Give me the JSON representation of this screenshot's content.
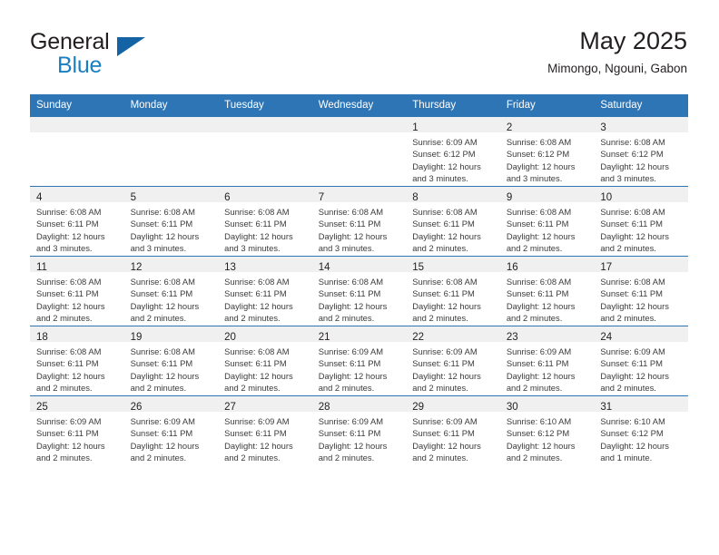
{
  "brand": {
    "line1": "General",
    "line2": "Blue",
    "flag_color": "#1464a5",
    "blue_color": "#1a7fc1"
  },
  "header": {
    "title": "May 2025",
    "subtitle": "Mimongo, Ngouni, Gabon"
  },
  "theme": {
    "header_bg": "#2e75b6",
    "daynum_bg": "#f0f0f0",
    "text": "#231f20"
  },
  "weekday_headers": [
    "Sunday",
    "Monday",
    "Tuesday",
    "Wednesday",
    "Thursday",
    "Friday",
    "Saturday"
  ],
  "labels": {
    "sunrise_prefix": "Sunrise:",
    "sunset_prefix": "Sunset:",
    "daylight_prefix": "Daylight:"
  },
  "weeks": [
    [
      {
        "day": "",
        "empty": true
      },
      {
        "day": "",
        "empty": true
      },
      {
        "day": "",
        "empty": true
      },
      {
        "day": "",
        "empty": true
      },
      {
        "day": "1",
        "sunrise": "Sunrise: 6:09 AM",
        "sunset": "Sunset: 6:12 PM",
        "daylight_1": "Daylight: 12 hours",
        "daylight_2": "and 3 minutes."
      },
      {
        "day": "2",
        "sunrise": "Sunrise: 6:08 AM",
        "sunset": "Sunset: 6:12 PM",
        "daylight_1": "Daylight: 12 hours",
        "daylight_2": "and 3 minutes."
      },
      {
        "day": "3",
        "sunrise": "Sunrise: 6:08 AM",
        "sunset": "Sunset: 6:12 PM",
        "daylight_1": "Daylight: 12 hours",
        "daylight_2": "and 3 minutes."
      }
    ],
    [
      {
        "day": "4",
        "sunrise": "Sunrise: 6:08 AM",
        "sunset": "Sunset: 6:11 PM",
        "daylight_1": "Daylight: 12 hours",
        "daylight_2": "and 3 minutes."
      },
      {
        "day": "5",
        "sunrise": "Sunrise: 6:08 AM",
        "sunset": "Sunset: 6:11 PM",
        "daylight_1": "Daylight: 12 hours",
        "daylight_2": "and 3 minutes."
      },
      {
        "day": "6",
        "sunrise": "Sunrise: 6:08 AM",
        "sunset": "Sunset: 6:11 PM",
        "daylight_1": "Daylight: 12 hours",
        "daylight_2": "and 3 minutes."
      },
      {
        "day": "7",
        "sunrise": "Sunrise: 6:08 AM",
        "sunset": "Sunset: 6:11 PM",
        "daylight_1": "Daylight: 12 hours",
        "daylight_2": "and 3 minutes."
      },
      {
        "day": "8",
        "sunrise": "Sunrise: 6:08 AM",
        "sunset": "Sunset: 6:11 PM",
        "daylight_1": "Daylight: 12 hours",
        "daylight_2": "and 2 minutes."
      },
      {
        "day": "9",
        "sunrise": "Sunrise: 6:08 AM",
        "sunset": "Sunset: 6:11 PM",
        "daylight_1": "Daylight: 12 hours",
        "daylight_2": "and 2 minutes."
      },
      {
        "day": "10",
        "sunrise": "Sunrise: 6:08 AM",
        "sunset": "Sunset: 6:11 PM",
        "daylight_1": "Daylight: 12 hours",
        "daylight_2": "and 2 minutes."
      }
    ],
    [
      {
        "day": "11",
        "sunrise": "Sunrise: 6:08 AM",
        "sunset": "Sunset: 6:11 PM",
        "daylight_1": "Daylight: 12 hours",
        "daylight_2": "and 2 minutes."
      },
      {
        "day": "12",
        "sunrise": "Sunrise: 6:08 AM",
        "sunset": "Sunset: 6:11 PM",
        "daylight_1": "Daylight: 12 hours",
        "daylight_2": "and 2 minutes."
      },
      {
        "day": "13",
        "sunrise": "Sunrise: 6:08 AM",
        "sunset": "Sunset: 6:11 PM",
        "daylight_1": "Daylight: 12 hours",
        "daylight_2": "and 2 minutes."
      },
      {
        "day": "14",
        "sunrise": "Sunrise: 6:08 AM",
        "sunset": "Sunset: 6:11 PM",
        "daylight_1": "Daylight: 12 hours",
        "daylight_2": "and 2 minutes."
      },
      {
        "day": "15",
        "sunrise": "Sunrise: 6:08 AM",
        "sunset": "Sunset: 6:11 PM",
        "daylight_1": "Daylight: 12 hours",
        "daylight_2": "and 2 minutes."
      },
      {
        "day": "16",
        "sunrise": "Sunrise: 6:08 AM",
        "sunset": "Sunset: 6:11 PM",
        "daylight_1": "Daylight: 12 hours",
        "daylight_2": "and 2 minutes."
      },
      {
        "day": "17",
        "sunrise": "Sunrise: 6:08 AM",
        "sunset": "Sunset: 6:11 PM",
        "daylight_1": "Daylight: 12 hours",
        "daylight_2": "and 2 minutes."
      }
    ],
    [
      {
        "day": "18",
        "sunrise": "Sunrise: 6:08 AM",
        "sunset": "Sunset: 6:11 PM",
        "daylight_1": "Daylight: 12 hours",
        "daylight_2": "and 2 minutes."
      },
      {
        "day": "19",
        "sunrise": "Sunrise: 6:08 AM",
        "sunset": "Sunset: 6:11 PM",
        "daylight_1": "Daylight: 12 hours",
        "daylight_2": "and 2 minutes."
      },
      {
        "day": "20",
        "sunrise": "Sunrise: 6:08 AM",
        "sunset": "Sunset: 6:11 PM",
        "daylight_1": "Daylight: 12 hours",
        "daylight_2": "and 2 minutes."
      },
      {
        "day": "21",
        "sunrise": "Sunrise: 6:09 AM",
        "sunset": "Sunset: 6:11 PM",
        "daylight_1": "Daylight: 12 hours",
        "daylight_2": "and 2 minutes."
      },
      {
        "day": "22",
        "sunrise": "Sunrise: 6:09 AM",
        "sunset": "Sunset: 6:11 PM",
        "daylight_1": "Daylight: 12 hours",
        "daylight_2": "and 2 minutes."
      },
      {
        "day": "23",
        "sunrise": "Sunrise: 6:09 AM",
        "sunset": "Sunset: 6:11 PM",
        "daylight_1": "Daylight: 12 hours",
        "daylight_2": "and 2 minutes."
      },
      {
        "day": "24",
        "sunrise": "Sunrise: 6:09 AM",
        "sunset": "Sunset: 6:11 PM",
        "daylight_1": "Daylight: 12 hours",
        "daylight_2": "and 2 minutes."
      }
    ],
    [
      {
        "day": "25",
        "sunrise": "Sunrise: 6:09 AM",
        "sunset": "Sunset: 6:11 PM",
        "daylight_1": "Daylight: 12 hours",
        "daylight_2": "and 2 minutes."
      },
      {
        "day": "26",
        "sunrise": "Sunrise: 6:09 AM",
        "sunset": "Sunset: 6:11 PM",
        "daylight_1": "Daylight: 12 hours",
        "daylight_2": "and 2 minutes."
      },
      {
        "day": "27",
        "sunrise": "Sunrise: 6:09 AM",
        "sunset": "Sunset: 6:11 PM",
        "daylight_1": "Daylight: 12 hours",
        "daylight_2": "and 2 minutes."
      },
      {
        "day": "28",
        "sunrise": "Sunrise: 6:09 AM",
        "sunset": "Sunset: 6:11 PM",
        "daylight_1": "Daylight: 12 hours",
        "daylight_2": "and 2 minutes."
      },
      {
        "day": "29",
        "sunrise": "Sunrise: 6:09 AM",
        "sunset": "Sunset: 6:11 PM",
        "daylight_1": "Daylight: 12 hours",
        "daylight_2": "and 2 minutes."
      },
      {
        "day": "30",
        "sunrise": "Sunrise: 6:10 AM",
        "sunset": "Sunset: 6:12 PM",
        "daylight_1": "Daylight: 12 hours",
        "daylight_2": "and 2 minutes."
      },
      {
        "day": "31",
        "sunrise": "Sunrise: 6:10 AM",
        "sunset": "Sunset: 6:12 PM",
        "daylight_1": "Daylight: 12 hours",
        "daylight_2": "and 1 minute."
      }
    ]
  ]
}
